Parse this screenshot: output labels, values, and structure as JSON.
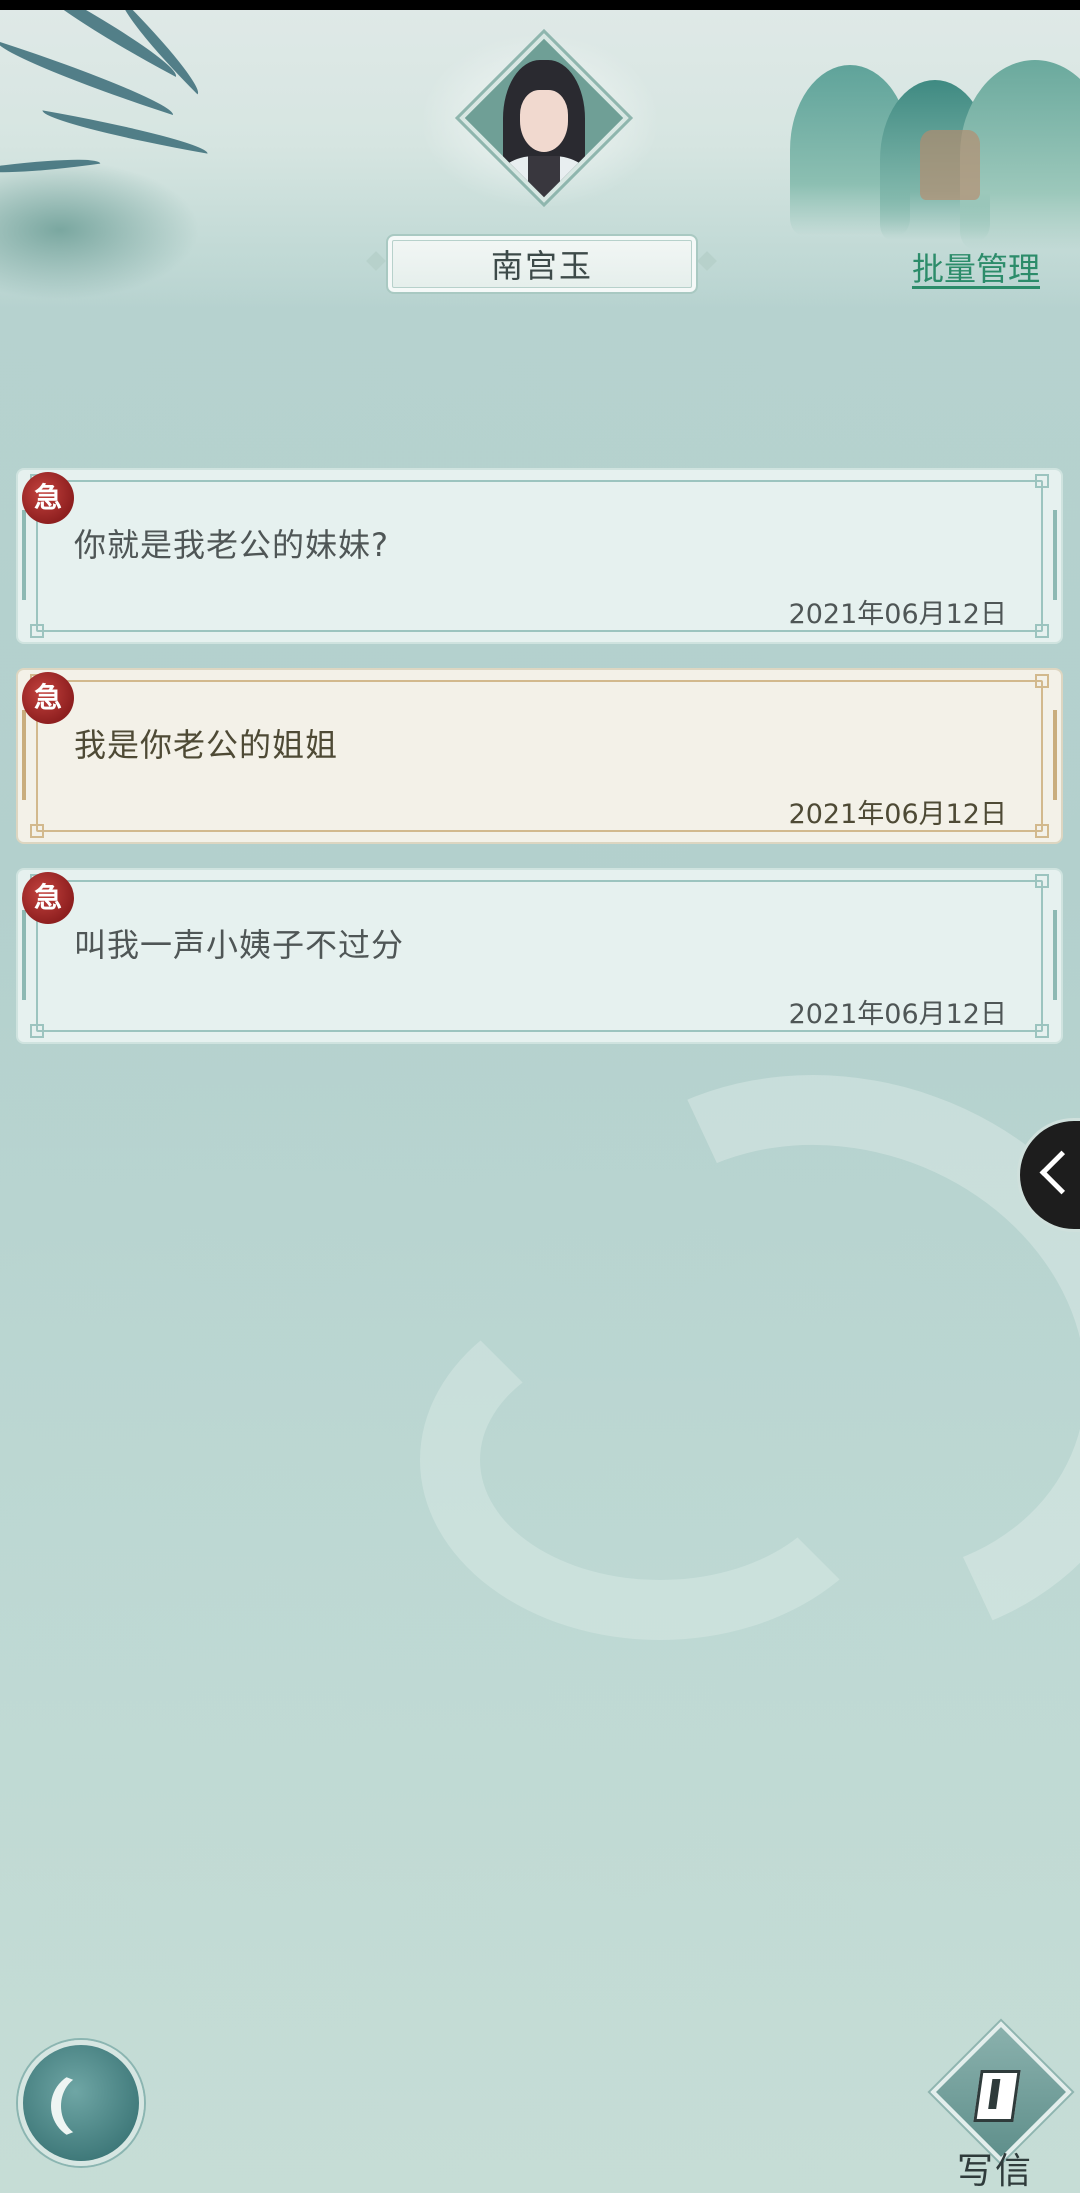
{
  "header": {
    "contact_name": "南宫玉",
    "batch_manage_label": "批量管理"
  },
  "messages": [
    {
      "seal_char": "急",
      "text": "你就是我老公的妹妹?",
      "date": "2021年06月12日",
      "style": "teal"
    },
    {
      "seal_char": "急",
      "text": "我是你老公的姐姐",
      "date": "2021年06月12日",
      "style": "beige"
    },
    {
      "seal_char": "急",
      "text": "叫我一声小姨子不过分",
      "date": "2021年06月12日",
      "style": "teal"
    }
  ],
  "footer": {
    "write_label": "写信"
  },
  "icons": {
    "back": "back-arrow-icon",
    "side_tab": "chevron-left-icon",
    "write": "write-letter-icon"
  },
  "colors": {
    "accent_link": "#2c8c6a",
    "seal_red": "#a52a27",
    "card_teal": "#e6f1ef",
    "card_beige": "#f3f1e8"
  }
}
